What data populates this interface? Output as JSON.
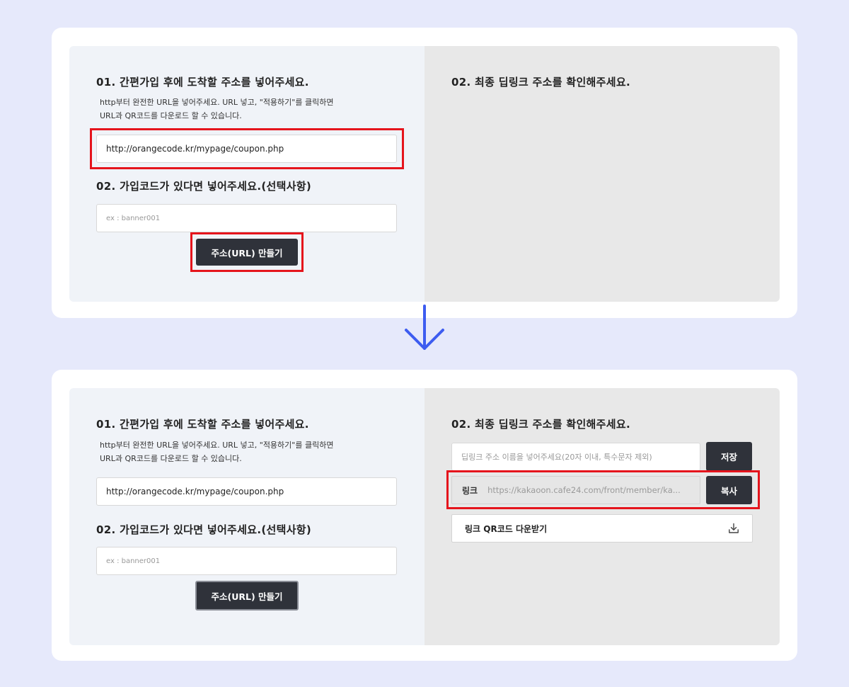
{
  "left_panel": {
    "step1_heading": "01. 간편가입 후에 도착할 주소를 넣어주세요.",
    "step1_help_line1": "http부터 완전한 URL을 넣어주세요. URL 넣고, \"적용하기\"를 클릭하면",
    "step1_help_line2": "URL과 QR코드를 다운로드 할 수 있습니다.",
    "url_value": "http://orangecode.kr/mypage/coupon.php",
    "step2_heading": "02. 가입코드가 있다면 넣어주세요.(선택사항)",
    "code_placeholder": "ex : banner001",
    "make_button_label": "주소(URL) 만들기"
  },
  "right_panel": {
    "heading": "02. 최종 딥링크 주소를 확인해주세요.",
    "name_placeholder": "딥링크 주소 이름을 넣어주세요(20자 이내, 특수문자 제외)",
    "save_button_label": "저장",
    "link_label": "링크",
    "link_url": "https://kakaoon.cafe24.com/front/member/ka...",
    "copy_button_label": "복사",
    "qr_download_label": "링크 QR코드 다운받기"
  },
  "icons": {
    "flow_arrow": "arrow-down-icon",
    "download": "download-icon"
  },
  "colors": {
    "highlight": "#e5141c",
    "arrow": "#3d5cf0",
    "button": "#2f323a"
  }
}
